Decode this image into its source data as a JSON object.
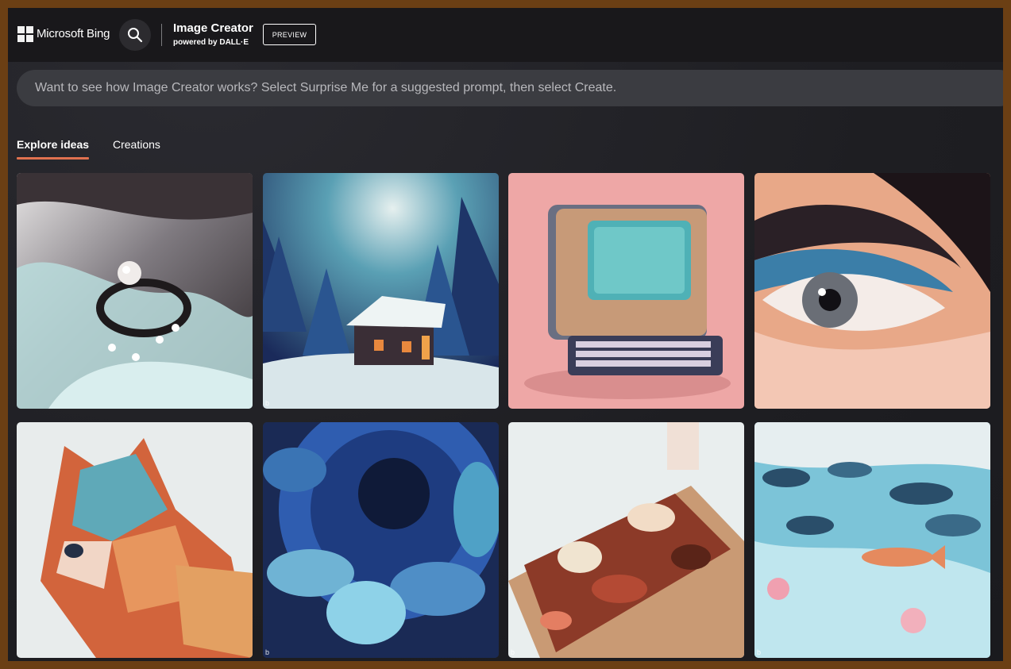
{
  "header": {
    "brand": "Microsoft Bing",
    "app_title": "Image Creator",
    "app_subtitle": "powered by DALL·E",
    "badge": "PREVIEW"
  },
  "prompt": {
    "placeholder": "Want to see how Image Creator works? Select Surprise Me for a suggested prompt, then select Create."
  },
  "tabs": [
    {
      "label": "Explore ideas",
      "active": true
    },
    {
      "label": "Creations",
      "active": false
    }
  ],
  "gallery": {
    "watermark": "b",
    "images": [
      {
        "subject": "pearl ring on satin"
      },
      {
        "subject": "snowy forest cabin"
      },
      {
        "subject": "retro computer on pink"
      },
      {
        "subject": "close-up eye with makeup"
      },
      {
        "subject": "geometric fox illustration"
      },
      {
        "subject": "blue dahlia flower"
      },
      {
        "subject": "charcuterie board"
      },
      {
        "subject": "koi pond with lily pads"
      }
    ]
  },
  "colors": {
    "accent": "#e0714f",
    "header_bg": "#19181b",
    "frame_border": "#6b3f14"
  }
}
